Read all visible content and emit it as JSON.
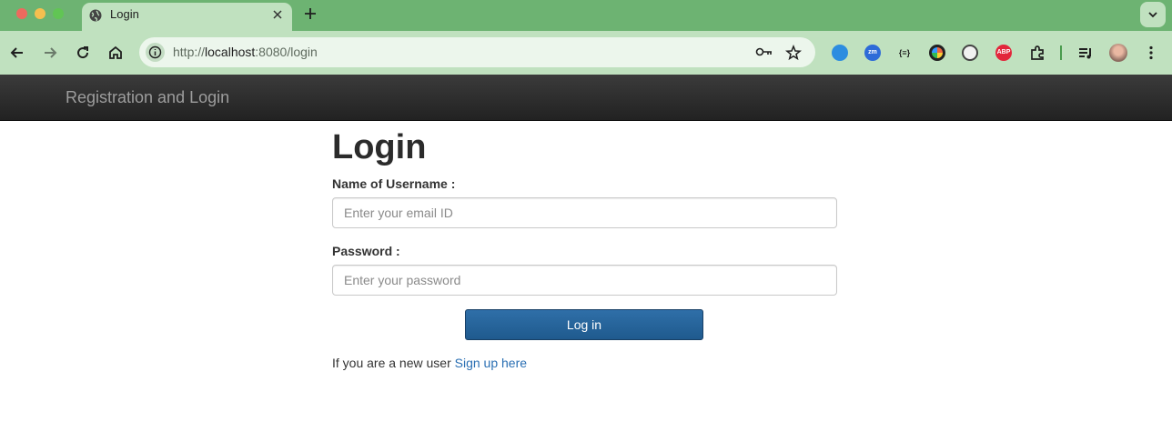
{
  "browser": {
    "tab_title": "Login",
    "url_prefix": "http://",
    "url_host": "localhost",
    "url_rest": ":8080/login",
    "extensions": [
      "sync-icon",
      "zoom-extension-icon",
      "json-extension-icon",
      "color-picker-icon",
      "ghostery-icon",
      "adblock-plus-icon",
      "extensions-puzzle-icon",
      "reading-list-icon",
      "profile-avatar"
    ],
    "ext_labels": {
      "zoom": "zm",
      "json": "{≡}",
      "abp": "ABP"
    },
    "accent": "#6db372"
  },
  "site": {
    "brand": "Registration and Login"
  },
  "form": {
    "title": "Login",
    "username_label": "Name of Username :",
    "username_placeholder": "Enter your email ID",
    "password_label": "Password :",
    "password_placeholder": "Enter your password",
    "submit_label": "Log in",
    "signup_prefix": "If you are a new user ",
    "signup_link": "Sign up here",
    "button_color": "#2a6aa3",
    "link_color": "#2a6fb3"
  }
}
